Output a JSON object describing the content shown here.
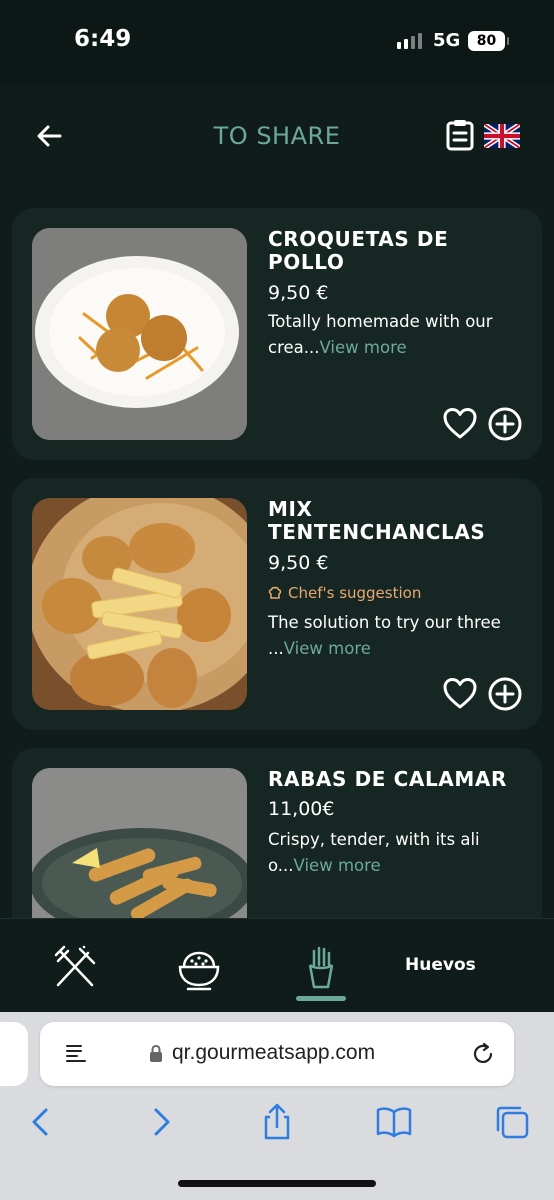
{
  "status_bar": {
    "time": "6:49",
    "network": "5G",
    "battery": "80"
  },
  "header": {
    "title": "TO SHARE",
    "back_icon": "arrow-left-icon",
    "clipboard_icon": "clipboard-icon",
    "language_flag": "uk-flag-icon"
  },
  "dishes": [
    {
      "name": "CROQUETAS DE POLLO",
      "price": "9,50 €",
      "description": "Totally homemade with our crea...",
      "view_more": "View more",
      "badge": ""
    },
    {
      "name": "MIX TENTENCHANCLAS",
      "price": "9,50 €",
      "description": "The solution to try our three ...",
      "view_more": "View more",
      "badge": "Chef's suggestion"
    },
    {
      "name": "RABAS DE CALAMAR",
      "price": "11,00€",
      "description": "Crispy, tender, with its ali o...",
      "view_more": "View more",
      "badge": ""
    }
  ],
  "bottom_nav": {
    "items": [
      "cutlery-icon",
      "rice-bowl-icon",
      "fries-icon"
    ],
    "label": "Huevos",
    "active_index": 2
  },
  "browser": {
    "url": "qr.gourmeatsapp.com"
  },
  "colors": {
    "accent": "#6ca999",
    "background": "#0f1c1a",
    "card": "#162623",
    "chef_badge": "#e8a86f"
  }
}
